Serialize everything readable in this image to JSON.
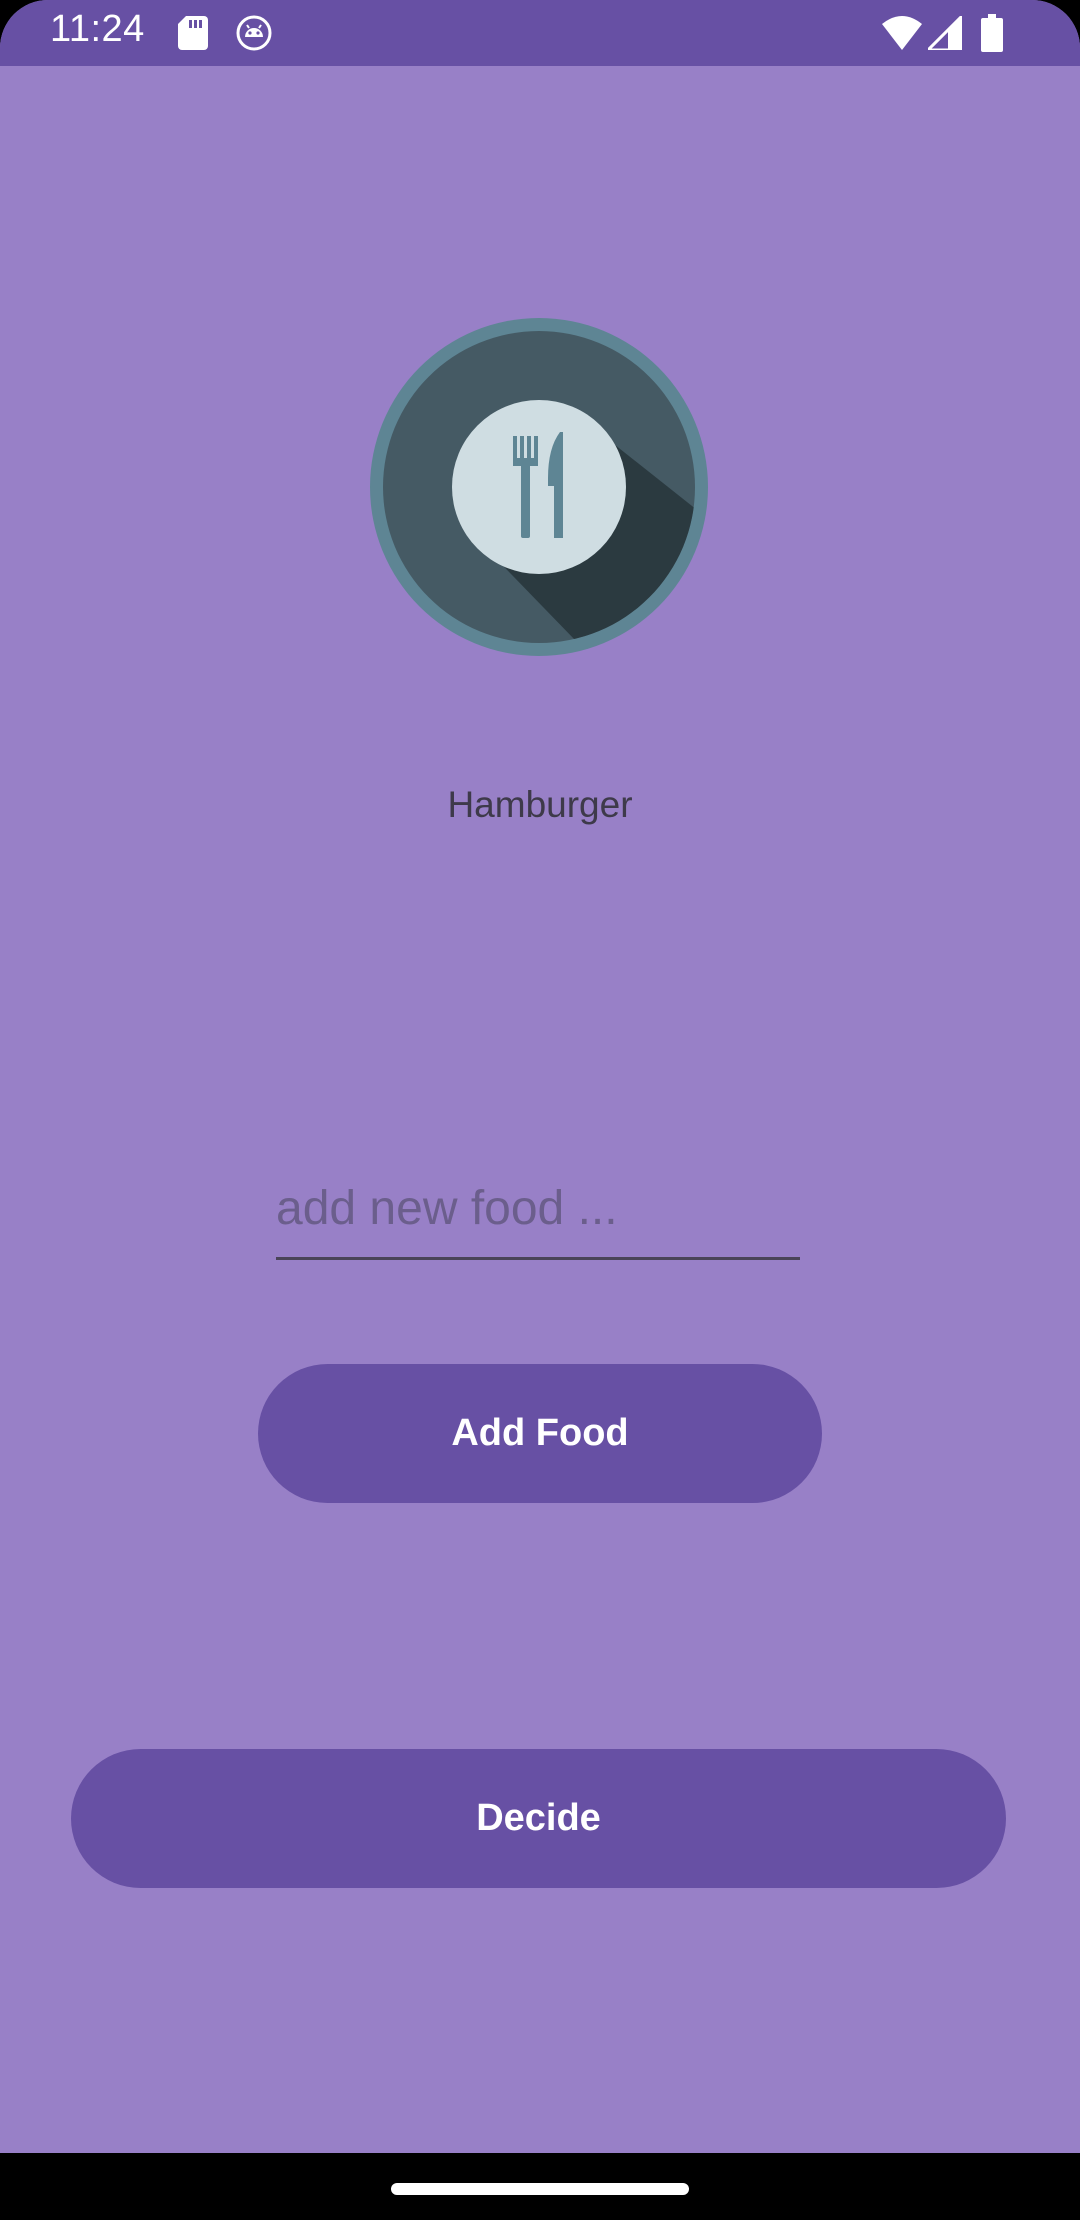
{
  "status_bar": {
    "time": "11:24",
    "left_icons": [
      "sd-card-icon",
      "android-debug-icon"
    ],
    "right_icons": [
      "wifi-icon",
      "cell-signal-icon",
      "battery-icon"
    ]
  },
  "app_icon": {
    "icon": "fork-knife-plate-icon"
  },
  "main": {
    "selected_food": "Hamburger",
    "food_input": {
      "value": "",
      "placeholder": "add new food ..."
    },
    "add_food_label": "Add Food",
    "decide_label": "Decide"
  },
  "colors": {
    "background": "#9880C7",
    "primary": "#6750A4",
    "on_primary": "#FFFFFF",
    "status_bar": "#6750A4",
    "nav_bar": "#000000"
  }
}
